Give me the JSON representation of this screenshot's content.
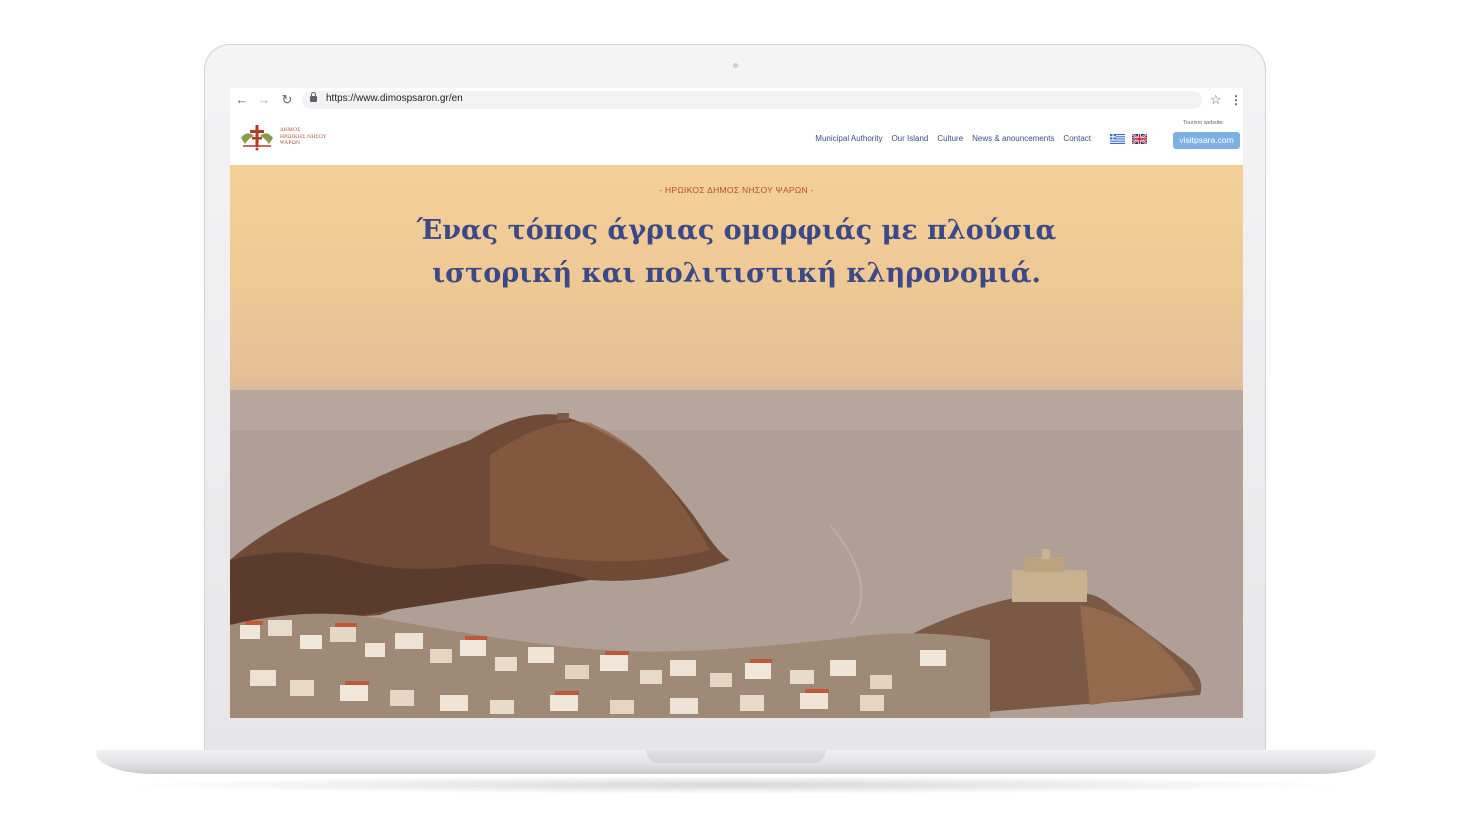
{
  "browser": {
    "url": "https://www.dimospsaron.gr/en",
    "back_icon": "arrow-left",
    "forward_icon": "arrow-right",
    "reload_icon": "reload",
    "bookmark_icon": "star",
    "menu_icon": "kebab-menu"
  },
  "site": {
    "logo_lines": [
      "ΔΗΜΟΣ",
      "ΗΡΩΙΚΗΣ ΝΗΣΟΥ",
      "ΨΑΡΩΝ"
    ],
    "nav": [
      "Municipal Authority",
      "Our Island",
      "Culture",
      "News & anouncements",
      "Contact"
    ],
    "languages": [
      "Greek",
      "English"
    ],
    "tourism_label": "Tourism website:",
    "tourism_button": "visitpsara.com"
  },
  "hero": {
    "eyebrow": "- ΗΡΩΙΚΟΣ ΔΗΜΟΣ ΝΗΣΟΥ ΨΑΡΩΝ -",
    "headline_line1": "Ένας τόπος άγριας ομορφιάς με πλούσια",
    "headline_line2": "ιστορική και πολιτιστική κληρονομιά."
  },
  "colors": {
    "nav_text": "#3c4d87",
    "headline": "#3b4a87",
    "eyebrow": "#b54a2f",
    "button": "#7fb0e3",
    "sky_top": "#f4d099"
  }
}
